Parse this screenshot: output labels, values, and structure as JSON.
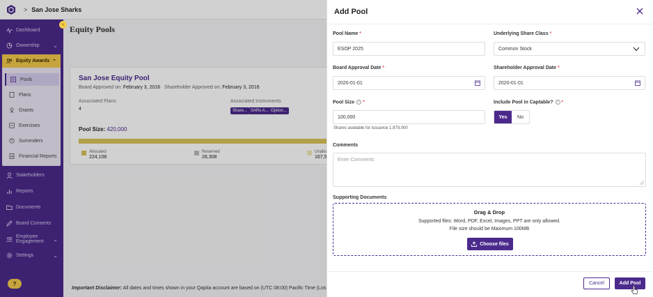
{
  "colors": {
    "brand": "#4b2a8c",
    "accent": "#f2c94c",
    "required": "#e25a5a"
  },
  "topbar": {
    "company": "San Jose Sharks",
    "icons": [
      "logo-hexagon-icon",
      "chevron-right-icon"
    ]
  },
  "sidebar": {
    "items": [
      {
        "label": "Dashboard",
        "icon": "pulse-icon"
      },
      {
        "label": "Ownership",
        "icon": "pie-chart-icon"
      },
      {
        "label": "Equity Awards",
        "icon": "users-icon"
      },
      {
        "label": "Stakeholders",
        "icon": "user-icon"
      },
      {
        "label": "Reports",
        "icon": "chart-icon"
      },
      {
        "label": "Documents",
        "icon": "folder-icon"
      },
      {
        "label": "Board Consents",
        "icon": "pen-icon"
      },
      {
        "label": "Employee Engagement",
        "icon": "people-icon"
      },
      {
        "label": "Settings",
        "icon": "gear-icon"
      }
    ],
    "sub_items": [
      {
        "label": "Pools",
        "icon": "list-icon"
      },
      {
        "label": "Plans",
        "icon": "document-icon"
      },
      {
        "label": "Grants",
        "icon": "grant-icon"
      },
      {
        "label": "Exercises",
        "icon": "exercise-icon"
      },
      {
        "label": "Surrenders",
        "icon": "surrender-icon"
      },
      {
        "label": "Financial Reports",
        "icon": "report-icon"
      }
    ],
    "help_label": "?"
  },
  "main": {
    "page_title": "Equity Pools",
    "card": {
      "pool_name": "San Jose Equity Pool",
      "board_approved_label": "Board Approved on:",
      "board_approved_value": "February 3, 2016",
      "shareholder_approved_label": "Shareholder Approved on:",
      "shareholder_approved_value": "February 3, 2016",
      "assoc_plans_label": "Associated Plans",
      "assoc_plans_value": "4",
      "assoc_instruments_label": "Associated Instruments",
      "chips": [
        "Share...",
        "SARs A...",
        "Option..."
      ],
      "pool_size_label": "Pool Size:",
      "pool_size_value": "420,000",
      "legend": [
        {
          "label": "Allocated",
          "value": "224,108",
          "color": "#d9c35a"
        },
        {
          "label": "Reserved",
          "value": "28,308",
          "color": "#bdbdbd"
        },
        {
          "label": "Unallo",
          "value": "167,5",
          "color": "#f2e9b6"
        }
      ]
    },
    "disclaimer_bold": "Important Disclaimer:",
    "disclaimer_text": " All dates and times shown in your Qapita account are based on (UTC 08:00) Pacific Time (Los Angeles)."
  },
  "modal": {
    "title": "Add Pool",
    "pool_name": {
      "label": "Pool Name",
      "value": "ESOP 2025"
    },
    "share_class": {
      "label": "Underlying Share Class",
      "value": "Common Stock"
    },
    "board_date": {
      "label": "Board Approval Date",
      "value": "2020-01-01"
    },
    "shareholder_date": {
      "label": "Shareholder Approval Date",
      "value": "2020-01-01"
    },
    "pool_size": {
      "label": "Pool Size",
      "value": "100,000",
      "hint": "Shares available for issuance 1,979,000"
    },
    "captable": {
      "label": "Include Pool in Captable?",
      "yes": "Yes",
      "no": "No",
      "selected": "Yes"
    },
    "comments": {
      "label": "Comments",
      "placeholder": "Enter Comments"
    },
    "documents": {
      "label": "Supporting Documents",
      "drop_title": "Drag & Drop",
      "drop_line1": "Supported files: Word, PDF, Excel, Images, PPT are only allowed.",
      "drop_line2": "File size should be Maximum 100MB",
      "choose_label": "Choose files"
    },
    "cancel_label": "Cancel",
    "submit_label": "Add Pool"
  }
}
